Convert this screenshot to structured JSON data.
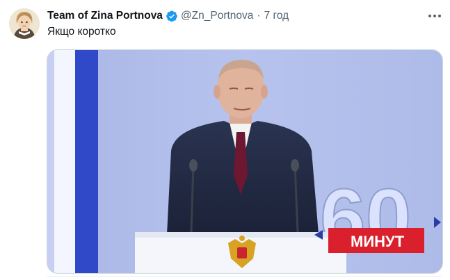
{
  "tweet": {
    "author_name": "Team of Zina Portnova",
    "handle": "@Zn_Portnova",
    "separator": "·",
    "time": "7 год",
    "text": "Якщо коротко"
  },
  "media": {
    "overlay_number": "60",
    "overlay_label": "МИНУТ"
  },
  "icons": {
    "verified": "verified-badge-icon",
    "more": "more-options-icon"
  },
  "colors": {
    "verified_blue": "#1d9bf0",
    "name_text": "#0f1419",
    "secondary_text": "#536471",
    "overlay_red": "#d9202c"
  }
}
